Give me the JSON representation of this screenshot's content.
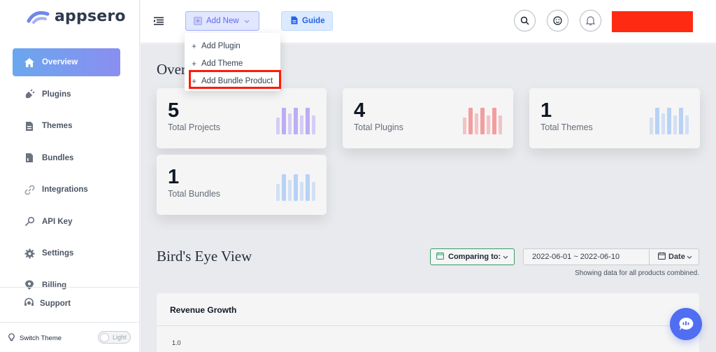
{
  "app": {
    "brand": "appsero"
  },
  "sidebar": {
    "items": [
      {
        "label": "Overview",
        "icon": "home-icon",
        "active": true
      },
      {
        "label": "Plugins",
        "icon": "plug-icon"
      },
      {
        "label": "Themes",
        "icon": "document-icon"
      },
      {
        "label": "Bundles",
        "icon": "document-icon"
      },
      {
        "label": "Integrations",
        "icon": "link-icon"
      },
      {
        "label": "API Key",
        "icon": "key-icon"
      },
      {
        "label": "Settings",
        "icon": "gear-icon"
      },
      {
        "label": "Billing",
        "icon": "location-icon"
      }
    ],
    "support_label": "Support",
    "switch_theme_label": "Switch Theme",
    "theme_toggle_label": "Light"
  },
  "header": {
    "add_new_label": "Add New",
    "guide_label": "Guide"
  },
  "add_new_menu": {
    "items": [
      "Add Plugin",
      "Add Theme",
      "Add Bundle Product"
    ],
    "highlighted_item": "Add Bundle Product"
  },
  "overview": {
    "title": "Overview",
    "cards": [
      {
        "value": "5",
        "label": "Total Projects",
        "accent": "#a78bfa"
      },
      {
        "value": "4",
        "label": "Total Plugins",
        "accent": "#f87171"
      },
      {
        "value": "1",
        "label": "Total Themes",
        "accent": "#93c5fd"
      },
      {
        "value": "1",
        "label": "Total Bundles",
        "accent": "#93c5fd"
      }
    ]
  },
  "birds_eye": {
    "title": "Bird's Eye View",
    "comparing_label": "Comparing to:",
    "date_range": "2022-06-01 ~ 2022-06-10",
    "date_button_label": "Date",
    "showing_text": "Showing data for all products combined."
  },
  "revenue": {
    "title": "Revenue Growth",
    "y_tick": "1.0"
  },
  "colors": {
    "accent": "#6366f1",
    "highlight_box": "#ff1a0a",
    "redacted_block": "#ff2a12",
    "chat_button": "#4f6ef2"
  }
}
